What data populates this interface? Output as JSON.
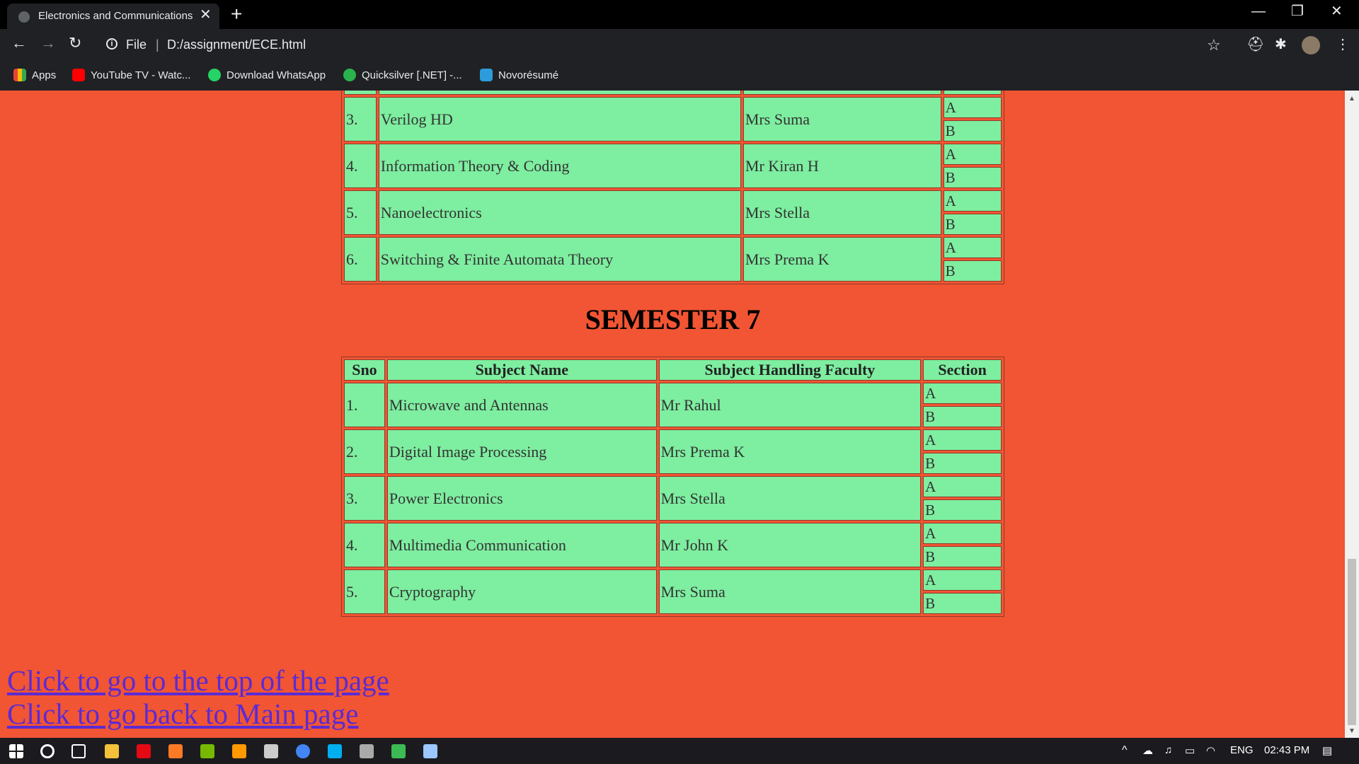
{
  "browser": {
    "tab_title": "Electronics and Communications",
    "tab_close": "✕",
    "new_tab": "+",
    "window_controls": {
      "minimize": "—",
      "restore": "❐",
      "close": "✕"
    },
    "nav": {
      "back": "←",
      "forward": "→",
      "reload": "↻"
    },
    "address": {
      "scheme": "File",
      "separator": "|",
      "url": "D:/assignment/ECE.html",
      "info": "i",
      "star": "☆"
    },
    "toolbar_icons": {
      "extension_1": "⛑",
      "extensions": "✱",
      "menu": "⋮"
    },
    "bookmarks": [
      {
        "label": "Apps",
        "icon": "apps-grid-icon",
        "color": "#ea4335"
      },
      {
        "label": "YouTube TV - Watc...",
        "icon": "youtube-icon",
        "color": "#ff0000"
      },
      {
        "label": "Download WhatsApp",
        "icon": "whatsapp-icon",
        "color": "#25d366"
      },
      {
        "label": "Quicksilver [.NET] -...",
        "icon": "quicksilver-icon",
        "color": "#2bb24c"
      },
      {
        "label": "Novorésumé",
        "icon": "novoresume-icon",
        "color": "#2d9cdb"
      }
    ]
  },
  "page": {
    "background": "#f25533",
    "cell_color": "#7eeea0",
    "semester6_rows": [
      {
        "sno": "3.",
        "subject": "Verilog HD",
        "faculty": "Mrs Suma",
        "sections": [
          "A",
          "B"
        ]
      },
      {
        "sno": "4.",
        "subject": "Information Theory & Coding",
        "faculty": "Mr Kiran H",
        "sections": [
          "A",
          "B"
        ]
      },
      {
        "sno": "5.",
        "subject": "Nanoelectronics",
        "faculty": "Mrs Stella",
        "sections": [
          "A",
          "B"
        ]
      },
      {
        "sno": "6.",
        "subject": "Switching & Finite Automata Theory",
        "faculty": "Mrs Prema K",
        "sections": [
          "A",
          "B"
        ]
      }
    ],
    "semester7": {
      "title": "SEMESTER 7",
      "headers": {
        "sno": "Sno",
        "subject": "Subject Name",
        "faculty": "Subject Handling Faculty",
        "section": "Section"
      },
      "rows": [
        {
          "sno": "1.",
          "subject": "Microwave and Antennas",
          "faculty": "Mr Rahul",
          "sections": [
            "A",
            "B"
          ]
        },
        {
          "sno": "2.",
          "subject": "Digital Image Processing",
          "faculty": "Mrs Prema K",
          "sections": [
            "A",
            "B"
          ]
        },
        {
          "sno": "3.",
          "subject": "Power Electronics",
          "faculty": "Mrs Stella",
          "sections": [
            "A",
            "B"
          ]
        },
        {
          "sno": "4.",
          "subject": "Multimedia Communication",
          "faculty": "Mr John K",
          "sections": [
            "A",
            "B"
          ]
        },
        {
          "sno": "5.",
          "subject": "Cryptography",
          "faculty": "Mrs Suma",
          "sections": [
            "A",
            "B"
          ]
        }
      ]
    },
    "links": {
      "top": "Click to go to the top of the page",
      "main": "Click to go back to Main page"
    }
  },
  "taskbar": {
    "apps": [
      {
        "icon": "file-explorer-icon",
        "color": "#f3c13a"
      },
      {
        "icon": "netflix-icon",
        "color": "#e50914"
      },
      {
        "icon": "xampp-icon",
        "color": "#fb7a24"
      },
      {
        "icon": "nvidia-icon",
        "color": "#76b900"
      },
      {
        "icon": "illustrator-icon",
        "color": "#ff9a00"
      },
      {
        "icon": "terminal-icon",
        "color": "#cccccc"
      },
      {
        "icon": "chrome-icon",
        "color": "#4285f4"
      },
      {
        "icon": "skype-icon",
        "color": "#00aff0"
      },
      {
        "icon": "video-editor-icon",
        "color": "#aaaaaa"
      },
      {
        "icon": "green-app-icon",
        "color": "#3cba54"
      },
      {
        "icon": "notepad-icon",
        "color": "#9cc7ff"
      }
    ],
    "language": "ENG",
    "time": "02:43 PM"
  }
}
